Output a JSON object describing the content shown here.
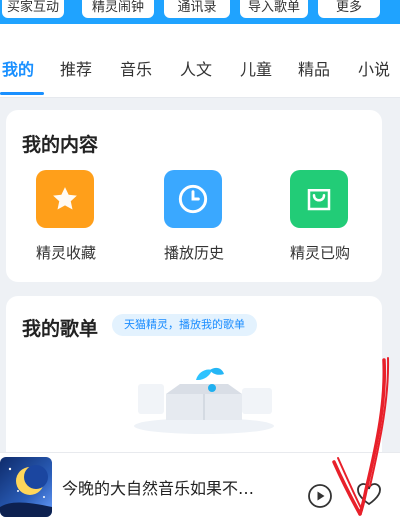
{
  "quick_actions": [
    "买家互动",
    "精灵闹钟",
    "通讯录",
    "导入歌单",
    "更多"
  ],
  "tabs": [
    "我的",
    "推荐",
    "音乐",
    "人文",
    "儿童",
    "精品",
    "小说"
  ],
  "active_tab": "我的",
  "my_content": {
    "title": "我的内容",
    "items": [
      {
        "label": "精灵收藏",
        "icon": "star-icon",
        "color": "#ff9f1a"
      },
      {
        "label": "播放历史",
        "icon": "clock-icon",
        "color": "#3aa8ff"
      },
      {
        "label": "精灵已购",
        "icon": "shopping-bag-icon",
        "color": "#22cc77"
      }
    ]
  },
  "my_playlists": {
    "title": "我的歌单",
    "badge": "天猫精灵，播放我的歌单",
    "empty_icon": "empty-box-icon"
  },
  "player": {
    "title": "今晚的大自然音乐如果不…",
    "cover_icon": "moon-cover-icon"
  },
  "colors": {
    "accent": "#1a90ff",
    "annotation": "#e8202a"
  }
}
